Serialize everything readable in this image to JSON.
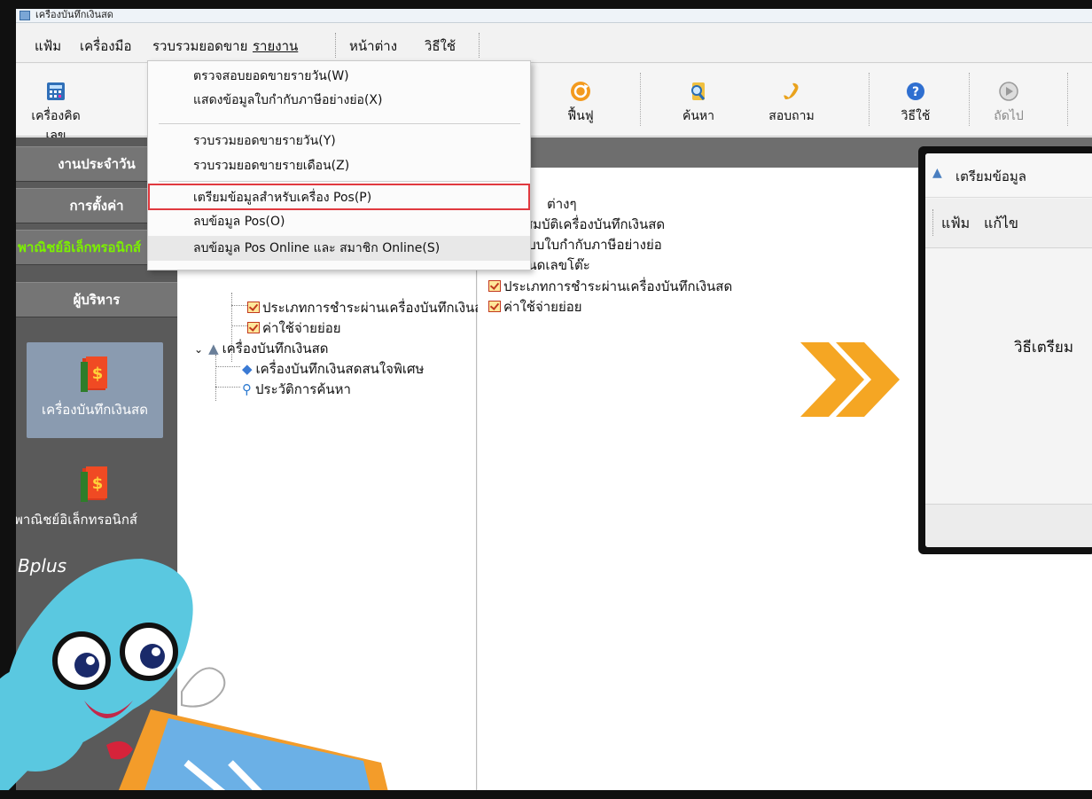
{
  "window": {
    "title": "เครื่องบันทึกเงินสด"
  },
  "menubar": {
    "items": [
      "แฟ้ม",
      "เครื่องมือ",
      "รวบรวมยอดขาย",
      "รายงาน",
      "หน้าต่าง",
      "วิธีใช้"
    ]
  },
  "toolbar": {
    "buttons": [
      {
        "label": "เครื่องคิดเลข",
        "icon": "calculator-icon"
      },
      {
        "label": "ฟื้นฟู",
        "icon": "refresh-icon"
      },
      {
        "label": "ค้นหา",
        "icon": "search-icon"
      },
      {
        "label": "สอบถาม",
        "icon": "phone-icon"
      },
      {
        "label": "วิธีใช้",
        "icon": "help-icon"
      },
      {
        "label": "ถัดไป",
        "icon": "next-icon"
      }
    ]
  },
  "sidebar": {
    "buttons": [
      "งานประจำวัน",
      "การตั้งค่า",
      "พาณิชย์อิเล็กทรอนิกส์",
      "ผู้บริหาร"
    ],
    "tiles": [
      "เครื่องบันทึกเงินสด",
      "พาณิชย์อิเล็กทรอนิกส์"
    ]
  },
  "dropdown": {
    "items": [
      "ตรวจสอบยอดขายรายวัน(W)",
      "แสดงข้อมูลใบกำกับภาษีอย่างย่อ(X)",
      "รวบรวมยอดขายรายวัน(Y)",
      "รวบรวมยอดขายรายเดือน(Z)",
      "เตรียมข้อมูลสำหรับเครื่อง Pos(P)",
      "ลบข้อมูล Pos(O)",
      "ลบข้อมูล Pos Online และ สมาชิก Online(S)"
    ]
  },
  "tree": {
    "items": [
      "ประเภทการชำระผ่านเครื่องบันทึกเงินสด",
      "ค่าใช้จ่ายย่อย",
      "เครื่องบันทึกเงินสด",
      "เครื่องบันทึกเงินสดสนใจพิเศษ",
      "ประวัติการค้นหา"
    ]
  },
  "content": {
    "items": [
      "ต่างๆ",
      "คุณสมบัติเครื่องบันทึกเงินสด",
      "รูปแบบใบกำกับภาษีอย่างย่อ",
      "กำหนดเลขโต๊ะ",
      "ประเภทการชำระผ่านเครื่องบันทึกเงินสด",
      "ค่าใช้จ่ายย่อย"
    ]
  },
  "popup": {
    "title": "เตรียมข้อมูล",
    "menu": [
      "แฟ้ม",
      "แก้ไข"
    ],
    "body": "วิธีเตรียม"
  },
  "mascot": {
    "brand": "Bplus"
  },
  "colors": {
    "highlight_border": "#e0393f",
    "sidebar_bg": "#5a5a5a",
    "arrow": "#f5a623"
  }
}
